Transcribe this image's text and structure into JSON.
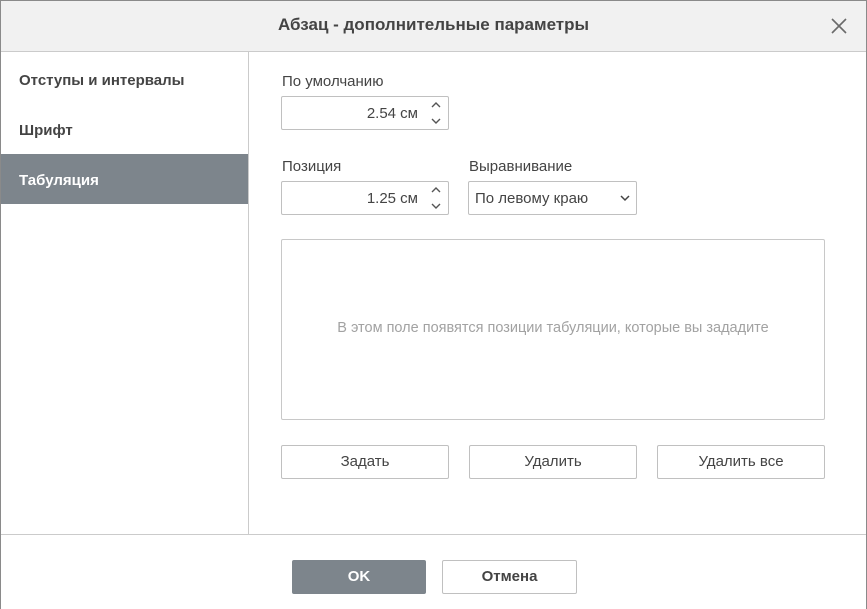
{
  "dialog": {
    "title": "Абзац - дополнительные параметры"
  },
  "sidebar": {
    "items": [
      {
        "label": "Отступы и интервалы",
        "active": false
      },
      {
        "label": "Шрифт",
        "active": false
      },
      {
        "label": "Табуляция",
        "active": true
      }
    ]
  },
  "tabs": {
    "default_label": "По умолчанию",
    "default_value": "2.54 см",
    "position_label": "Позиция",
    "position_value": "1.25 см",
    "alignment_label": "Выравнивание",
    "alignment_value": "По левому краю",
    "list_placeholder": "В этом поле появятся позиции табуляции, которые вы зададите",
    "set_button": "Задать",
    "delete_button": "Удалить",
    "delete_all_button": "Удалить все"
  },
  "footer": {
    "ok_label": "OK",
    "cancel_label": "Отмена"
  },
  "colors": {
    "accent": "#7d858c",
    "header_bg": "#f1f1f1",
    "border": "#c0c0c0",
    "placeholder_text": "#a2a2a2"
  },
  "icons": [
    "close-icon",
    "spinner-up-icon",
    "spinner-down-icon",
    "chevron-down-icon"
  ]
}
